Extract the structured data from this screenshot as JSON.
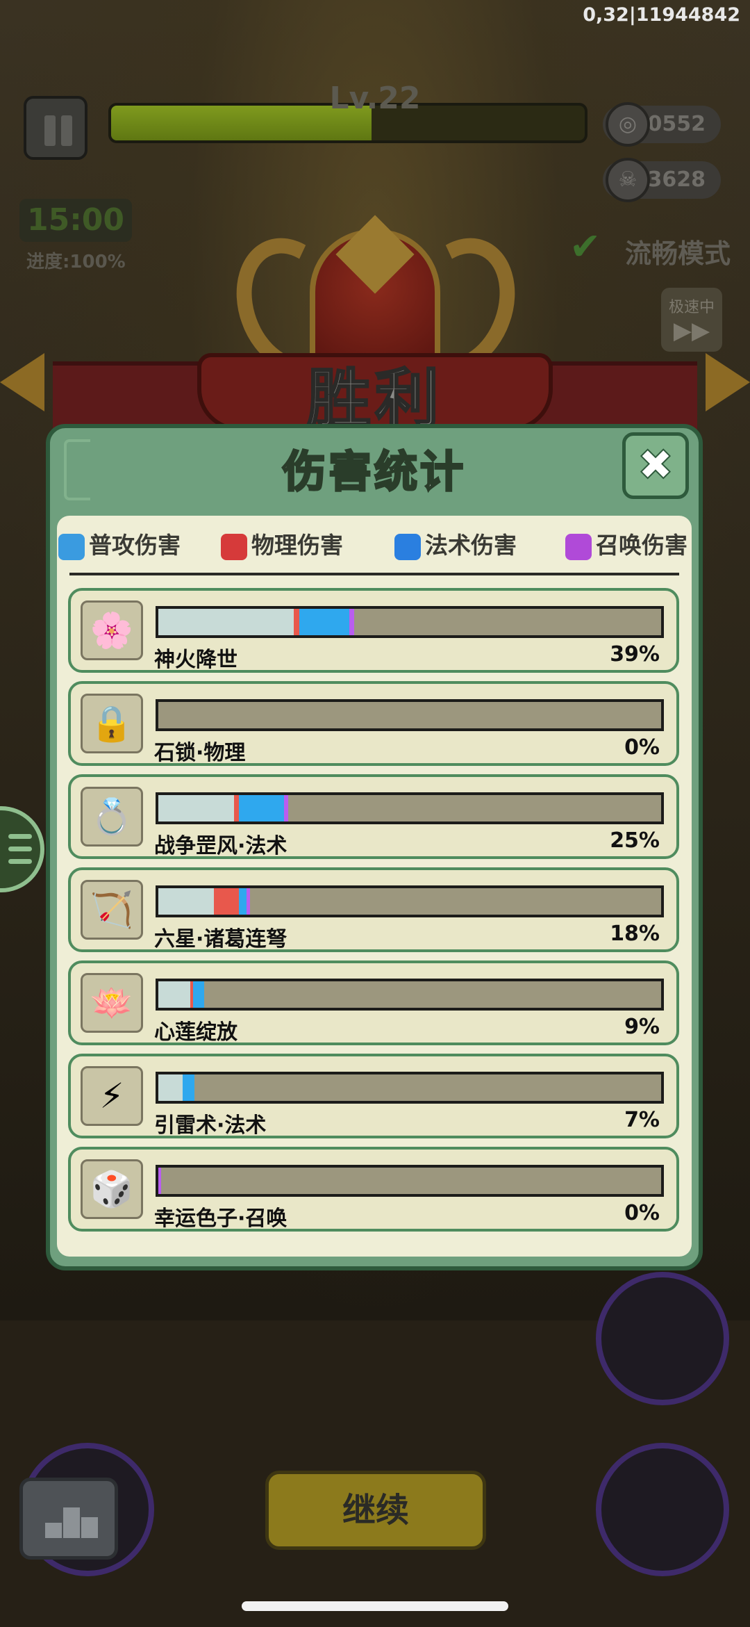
{
  "hud": {
    "debug": "0,32|11944842",
    "level": "Lv.22",
    "level_progress": 0.55,
    "coins": "40552",
    "kills": "3628",
    "timer": "15:00",
    "progress": "进度:100%",
    "smooth_mode": "流畅模式",
    "speed_label": "极速中"
  },
  "victory": {
    "title": "胜利"
  },
  "panel": {
    "title": "伤害统计",
    "legend": [
      {
        "label": "普攻伤害",
        "icon": "sword-icon",
        "color": "#3a9be0"
      },
      {
        "label": "物理伤害",
        "icon": "claw-icon",
        "color": "#d63a3a"
      },
      {
        "label": "法术伤害",
        "icon": "flame-icon",
        "color": "#2a7fe0"
      },
      {
        "label": "召唤伤害",
        "icon": "paw-icon",
        "color": "#b04ad8"
      }
    ],
    "segment_colors": {
      "normal": "#c8dbd7",
      "physical": "#e8584c",
      "magic": "#2fa8ee",
      "summon": "#b95ef0"
    },
    "rows": [
      {
        "name": "神火降世",
        "pct": "39%",
        "icon": "fire-lotus-icon",
        "segments": {
          "normal": 27,
          "physical": 1,
          "magic": 10,
          "summon": 1
        }
      },
      {
        "name": "石锁·物理",
        "pct": "0%",
        "icon": "stone-lock-icon",
        "segments": {
          "normal": 0,
          "physical": 0,
          "magic": 0,
          "summon": 0
        }
      },
      {
        "name": "战争罡风·法术",
        "pct": "25%",
        "icon": "golden-ring-icon",
        "segments": {
          "normal": 15,
          "physical": 1,
          "magic": 9,
          "summon": 0.8
        }
      },
      {
        "name": "六星·诸葛连弩",
        "pct": "18%",
        "icon": "crossbow-icon",
        "segments": {
          "normal": 11,
          "physical": 5,
          "magic": 1.6,
          "summon": 0.6
        }
      },
      {
        "name": "心莲绽放",
        "pct": "9%",
        "icon": "purple-lotus-icon",
        "segments": {
          "normal": 6.4,
          "physical": 0.5,
          "magic": 2.2,
          "summon": 0
        }
      },
      {
        "name": "引雷术·法术",
        "pct": "7%",
        "icon": "lightning-icon",
        "segments": {
          "normal": 4.8,
          "physical": 0,
          "magic": 2.4,
          "summon": 0
        }
      },
      {
        "name": "幸运色子·召唤",
        "pct": "0%",
        "icon": "dice-icon",
        "segments": {
          "normal": 0,
          "physical": 0,
          "magic": 0,
          "summon": 0.5
        }
      }
    ]
  },
  "bottom": {
    "continue": "继续"
  }
}
